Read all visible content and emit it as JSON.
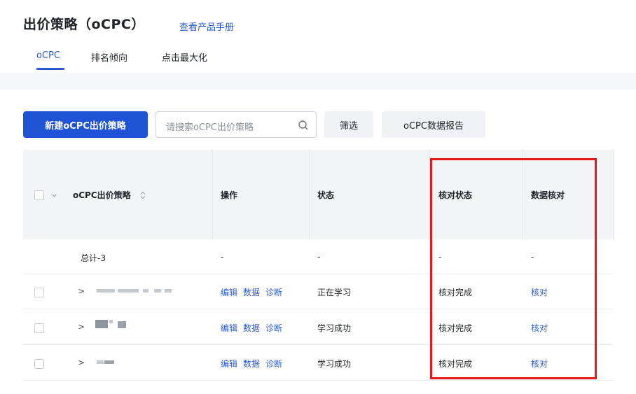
{
  "header": {
    "title": "出价策略（oCPC）",
    "manual_link": "查看产品手册",
    "tabs": [
      {
        "label": "oCPC",
        "active": true
      },
      {
        "label": "排名倾向",
        "active": false
      },
      {
        "label": "点击最大化",
        "active": false
      }
    ]
  },
  "toolbar": {
    "new_button": "新建oCPC出价策略",
    "search_placeholder": "请搜索oCPC出价策略",
    "filter_button": "筛选",
    "report_button": "oCPC数据报告"
  },
  "table": {
    "columns": [
      "oCPC出价策略",
      "操作",
      "状态",
      "核对状态",
      "数据核对"
    ],
    "sort_icon": "sort-icon",
    "total_row": {
      "name": "总计-3",
      "ops": "-",
      "status": "-",
      "verify_status": "-",
      "verify": "-"
    },
    "rows": [
      {
        "ops": [
          "编辑",
          "数据",
          "诊断"
        ],
        "status": "正在学习",
        "verify_status": "核对完成",
        "verify": "核对"
      },
      {
        "ops": [
          "编辑",
          "数据",
          "诊断"
        ],
        "status": "学习成功",
        "verify_status": "核对完成",
        "verify": "核对"
      },
      {
        "ops": [
          "编辑",
          "数据",
          "诊断"
        ],
        "status": "学习成功",
        "verify_status": "核对完成",
        "verify": "核对"
      }
    ]
  },
  "colors": {
    "accent": "#2b5cd6",
    "primary_button": "#1f53d6",
    "highlight": "#e5191c"
  }
}
